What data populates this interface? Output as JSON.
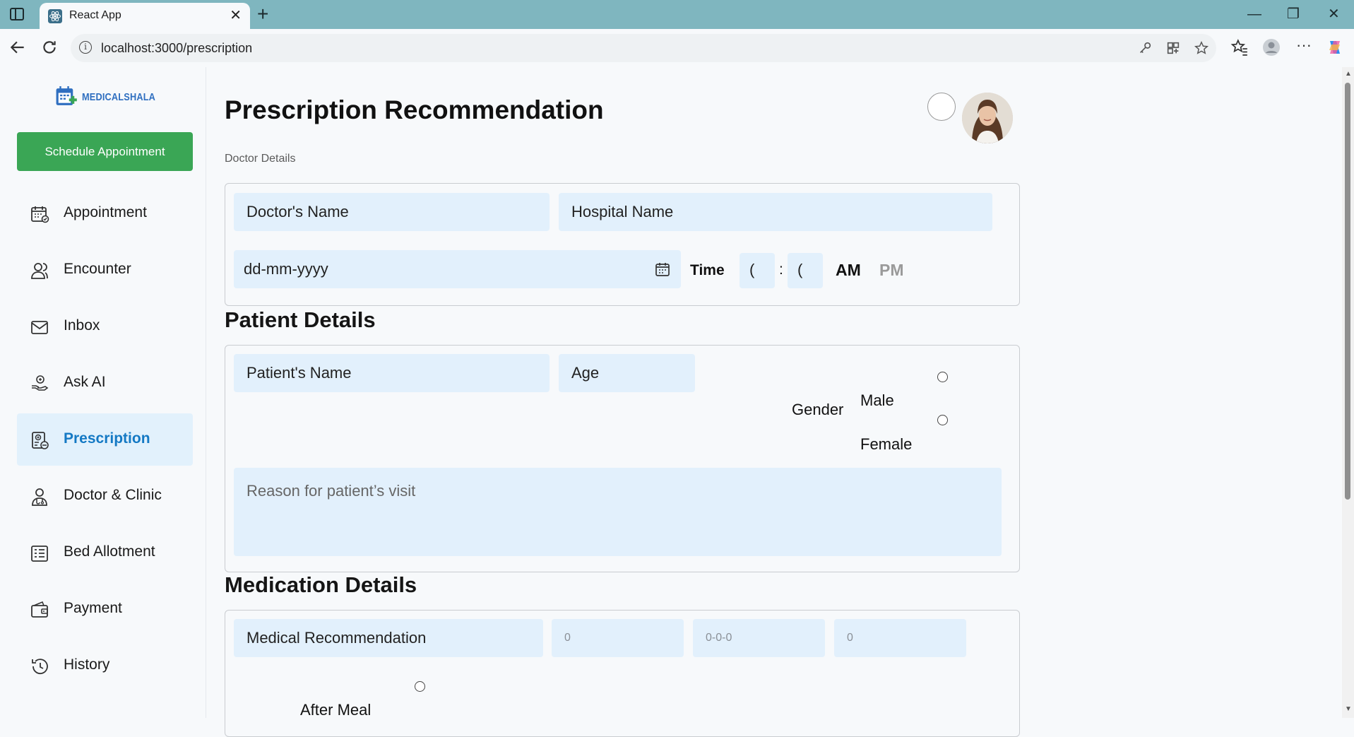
{
  "browser": {
    "tab_title": "React App",
    "url": "localhost:3000/prescription"
  },
  "sidebar": {
    "brand": "MEDICALSHALA",
    "schedule_button": "Schedule Appointment",
    "items": [
      {
        "label": "Appointment",
        "icon": "calendar-icon",
        "active": false
      },
      {
        "label": "Encounter",
        "icon": "users-icon",
        "active": false
      },
      {
        "label": "Inbox",
        "icon": "mail-icon",
        "active": false
      },
      {
        "label": "Ask AI",
        "icon": "ai-hand-icon",
        "active": false
      },
      {
        "label": "Prescription",
        "icon": "prescription-icon",
        "active": true
      },
      {
        "label": "Doctor & Clinic",
        "icon": "doctor-icon",
        "active": false
      },
      {
        "label": "Bed Allotment",
        "icon": "bed-list-icon",
        "active": false
      },
      {
        "label": "Payment",
        "icon": "wallet-icon",
        "active": false
      },
      {
        "label": "History",
        "icon": "history-icon",
        "active": false
      }
    ]
  },
  "main": {
    "title": "Prescription Recommendation",
    "doctor_section": "Doctor Details",
    "doctor": {
      "name_placeholder": "Doctor's Name",
      "hospital_placeholder": "Hospital Name",
      "date_placeholder": "dd-mm-yyyy",
      "time_label": "Time",
      "hour_value": "(",
      "separator": ":",
      "minute_value": "(",
      "am": "AM",
      "pm": "PM"
    },
    "patient_section": "Patient Details",
    "patient": {
      "name_placeholder": "Patient's Name",
      "age_placeholder": "Age",
      "gender_label": "Gender",
      "male": "Male",
      "female": "Female",
      "reason_placeholder": "Reason for patient’s visit"
    },
    "medication_section": "Medication Details",
    "medication": {
      "recommendation_placeholder": "Medical Recommendation",
      "field2_placeholder": "0",
      "field3_placeholder": "0-0-0",
      "field4_placeholder": "0",
      "after_meal": "After Meal"
    }
  },
  "colors": {
    "accent_green": "#3aa655",
    "active_blue": "#1479c4",
    "field_bg": "#e2f0fc",
    "titlebar": "#7fb6bf"
  }
}
